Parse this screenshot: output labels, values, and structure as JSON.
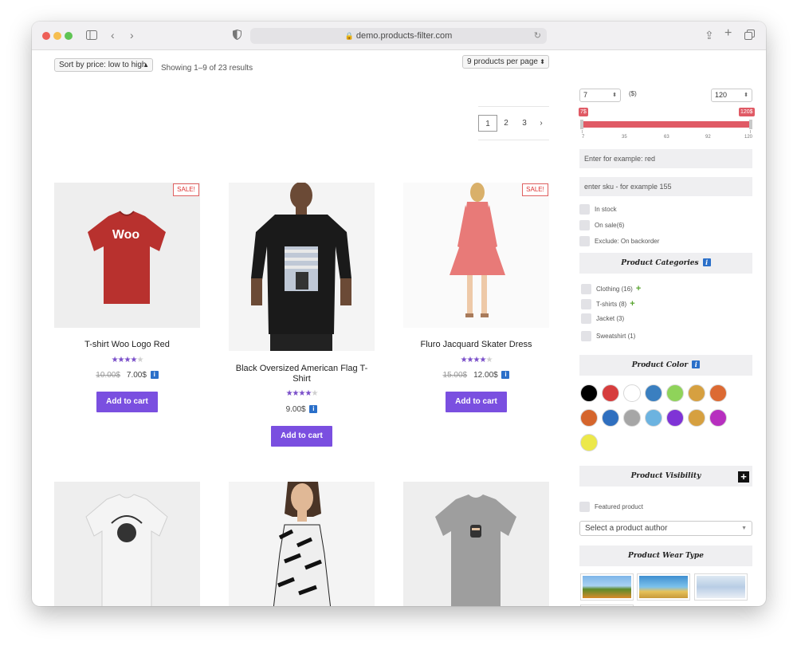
{
  "browser": {
    "url": "demo.products-filter.com"
  },
  "toolbar": {
    "sort_value": "Sort by price: low to high",
    "results_text": "Showing 1–9 of 23 results",
    "per_page_value": "9 products per page"
  },
  "pagination": {
    "pages": [
      "1",
      "2",
      "3"
    ],
    "next": "›"
  },
  "products": [
    {
      "title": "T-shirt Woo Logo Red",
      "old_price": "10.00$",
      "price": "7.00$",
      "sale": "SALE!",
      "rating": 4
    },
    {
      "title": "Black Oversized American Flag T-Shirt",
      "old_price": "",
      "price": "9.00$",
      "sale": "",
      "rating": 4
    },
    {
      "title": "Fluro Jacquard Skater Dress",
      "old_price": "15.00$",
      "price": "12.00$",
      "sale": "SALE!",
      "rating": 4
    }
  ],
  "cart_label": "Add to cart",
  "shirt_logo_text": "Woo",
  "filter": {
    "price_min": "7",
    "price_max": "120",
    "currency": "($)",
    "min_badge": "7$",
    "max_badge": "120$",
    "slider_ticks": [
      "7",
      "35",
      "63",
      "92",
      "120"
    ],
    "text_placeholder": "Enter for example: red",
    "sku_placeholder": "enter sku - for example 155",
    "in_stock": "In stock",
    "on_sale": "On sale(6)",
    "exclude": "Exclude: On backorder",
    "categories_title": "Product Categories",
    "categories": [
      {
        "label": "Clothing (16)",
        "expandable": true
      },
      {
        "label": "T-shirts (8)",
        "expandable": true
      },
      {
        "label": "Jacket (3)",
        "expandable": false
      },
      {
        "label": "Sweatshirt (1)",
        "expandable": false
      }
    ],
    "color_title": "Product Color",
    "colors": [
      "#000000",
      "#d63d3d",
      "#ffffff",
      "#3a7fc0",
      "#8fd35a",
      "#d6a040",
      "#dc6a33",
      "#d5652c",
      "#2f6fbf",
      "#a6a6a6",
      "#6cb3e0",
      "#7f33d6",
      "#d6a040",
      "#b72fbf",
      "#ece84a"
    ],
    "visibility_title": "Product Visibility",
    "featured": "Featured product",
    "author_placeholder": "Select a product author",
    "wear_title": "Product Wear Type"
  }
}
